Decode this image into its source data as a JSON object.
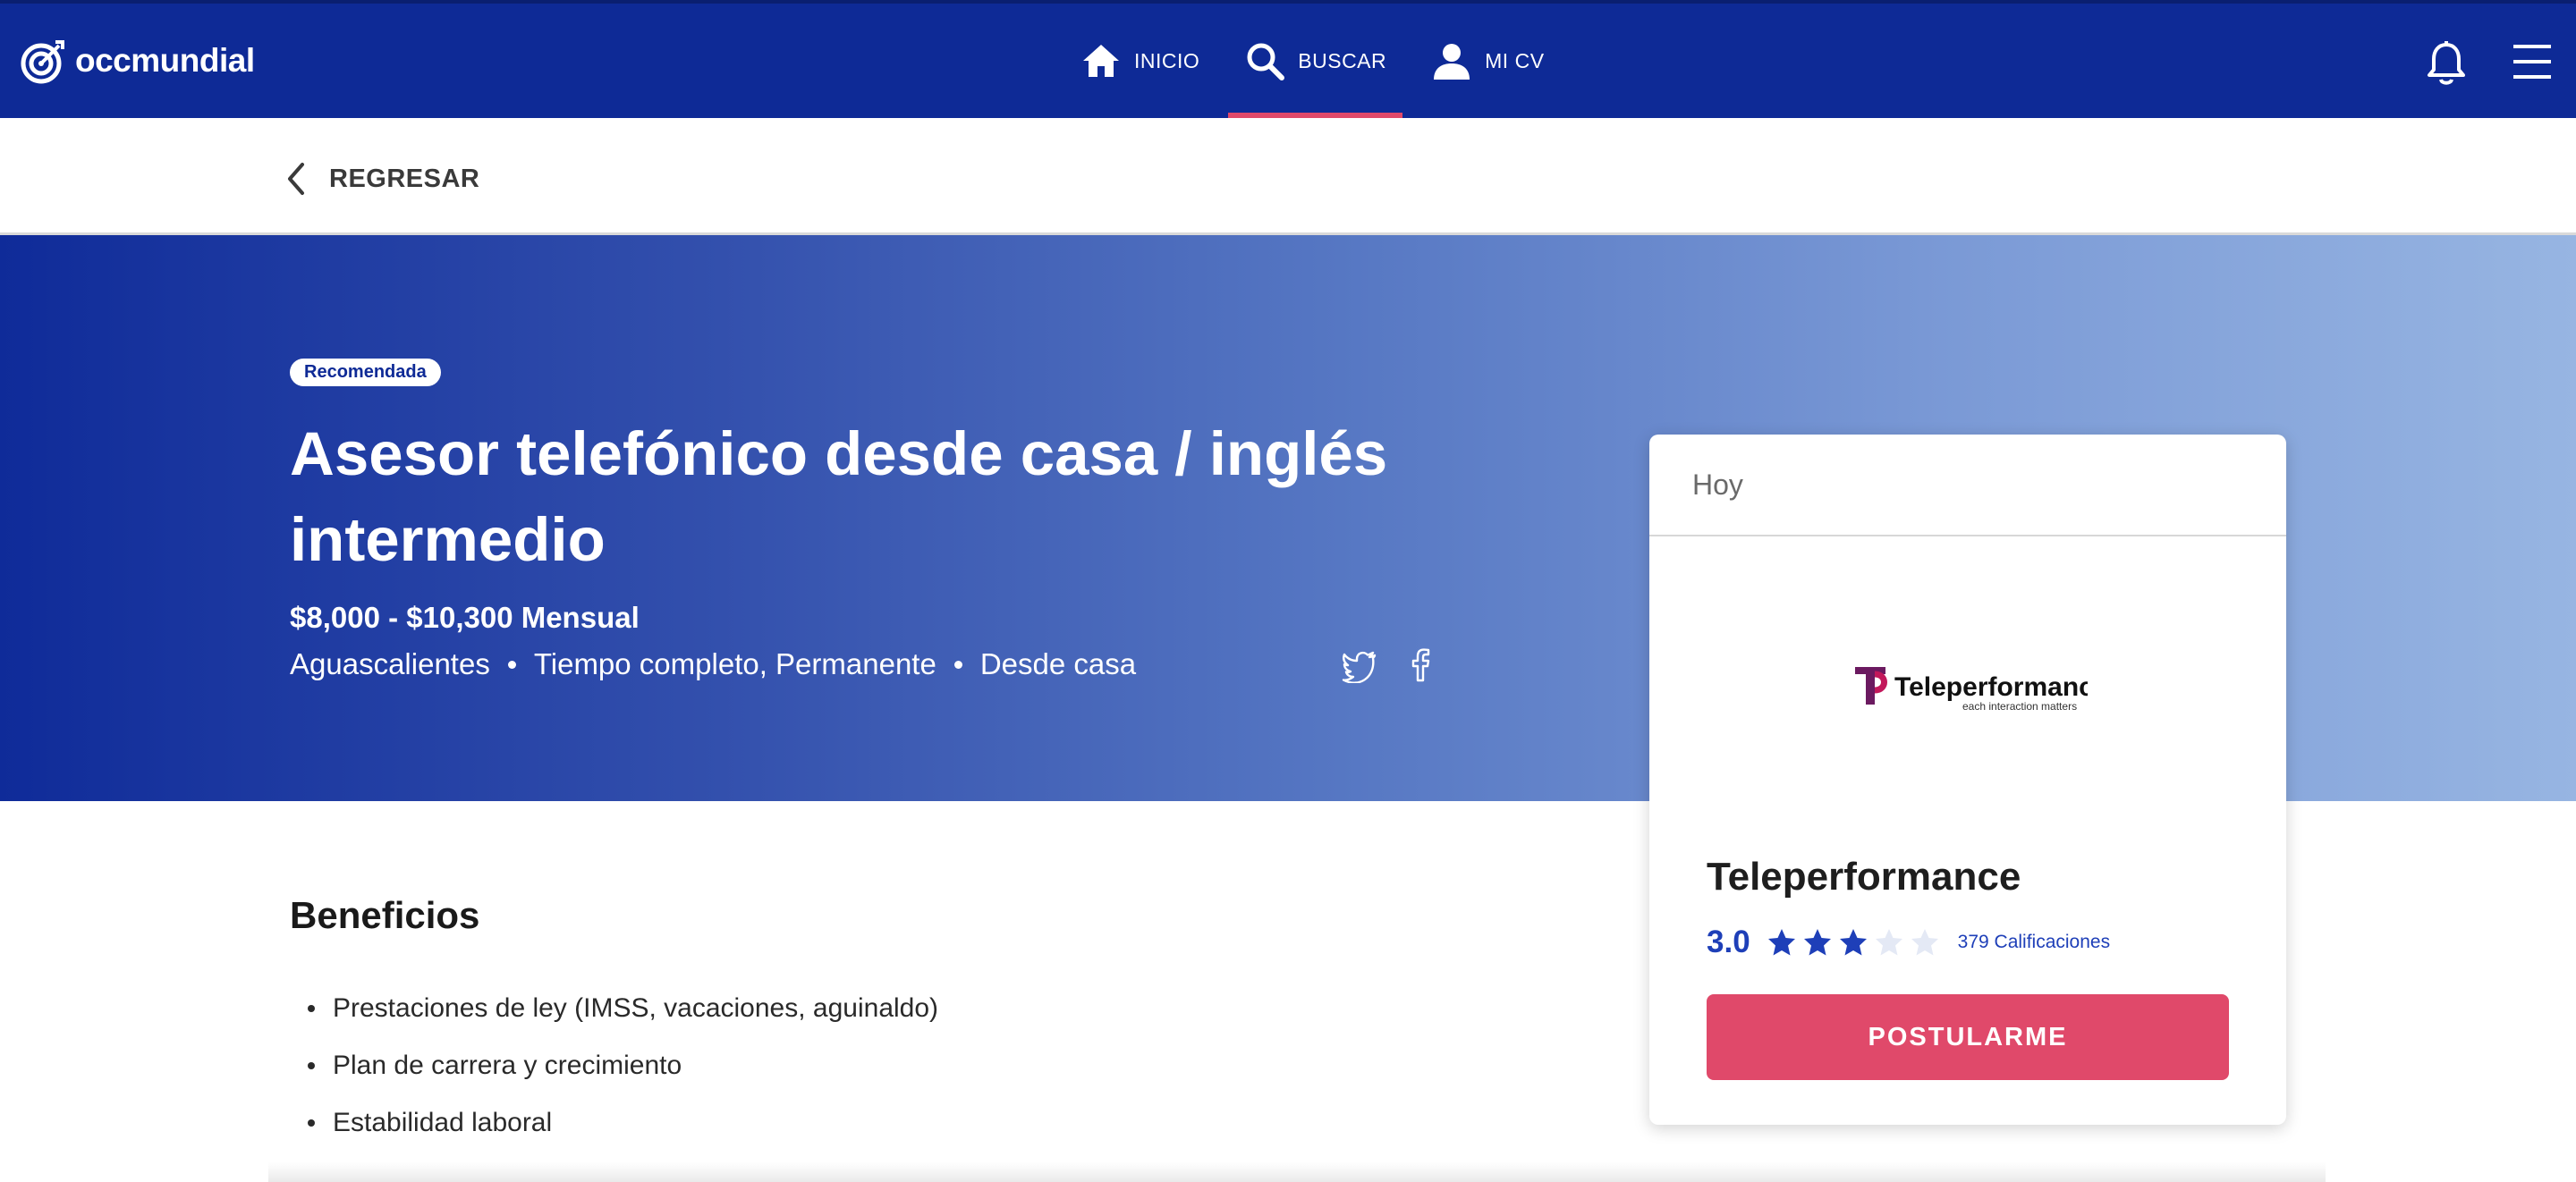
{
  "brand": {
    "logo_text": "occmundial"
  },
  "nav": {
    "items": [
      {
        "label": "INICIO",
        "icon": "home-icon"
      },
      {
        "label": "BUSCAR",
        "icon": "search-icon",
        "active": true
      },
      {
        "label": "MI CV",
        "icon": "user-icon"
      }
    ],
    "right_icons": [
      "bell-icon",
      "hamburger-menu-icon"
    ]
  },
  "back": {
    "label": "REGRESAR"
  },
  "job": {
    "badge": "Recomendada",
    "title": "Asesor telefónico desde casa / inglés intermedio",
    "salary": "$8,000 - $10,300 Mensual",
    "location": "Aguascalientes",
    "schedule": "Tiempo completo, Permanente",
    "modality": "Desde casa"
  },
  "card": {
    "date": "Hoy",
    "company_logo_text": "Teleperformance",
    "company_logo_tagline": "each interaction matters",
    "company_name": "Teleperformance",
    "rating": "3.0",
    "rating_value": 3,
    "rating_max": 5,
    "ratings_count": "379 Calificaciones",
    "apply_label": "POSTULARME"
  },
  "benefits": {
    "title": "Beneficios",
    "items": [
      "Prestaciones de ley (IMSS, vacaciones, aguinaldo)",
      "Plan de carrera y crecimiento",
      "Estabilidad laboral"
    ]
  },
  "colors": {
    "nav_bg": "#0e2a96",
    "accent": "#e0496a",
    "link": "#1e3fb8",
    "star_filled": "#1e3fb8",
    "star_empty": "#e4e9f5"
  }
}
